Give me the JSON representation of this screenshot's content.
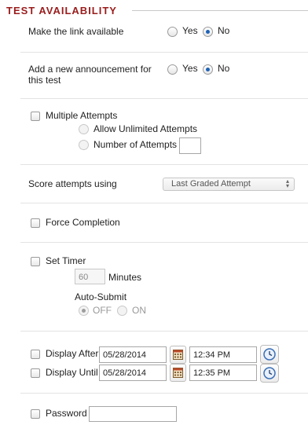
{
  "section": {
    "title": "TEST AVAILABILITY"
  },
  "make_link": {
    "label": "Make the link available",
    "yes": "Yes",
    "no": "No",
    "selected": "No"
  },
  "announcement": {
    "label_line1": "Add a new announcement for",
    "label_line2": "this test",
    "yes": "Yes",
    "no": "No",
    "selected": "No"
  },
  "multiple_attempts": {
    "label": "Multiple Attempts",
    "checked": false,
    "allow_unlimited": "Allow Unlimited Attempts",
    "number_of_attempts": "Number of Attempts",
    "number_value": ""
  },
  "score_attempts": {
    "label": "Score attempts using",
    "selected": "Last Graded Attempt"
  },
  "force_completion": {
    "label": "Force Completion",
    "checked": false
  },
  "set_timer": {
    "label": "Set Timer",
    "checked": false,
    "minutes_value": "60",
    "minutes_label": "Minutes",
    "auto_submit_label": "Auto-Submit",
    "off": "OFF",
    "on": "ON",
    "selected": "OFF"
  },
  "display_after": {
    "label": "Display After",
    "date": "05/28/2014",
    "time": "12:34 PM",
    "checked": false
  },
  "display_until": {
    "label": "Display Until",
    "date": "05/28/2014",
    "time": "12:35 PM",
    "checked": false
  },
  "password": {
    "label": "Password",
    "value": ""
  },
  "colors": {
    "section_title": "#9a1c1c",
    "radio_selected": "#1e63b6"
  },
  "icons": {
    "calendar": "calendar-icon",
    "clock": "clock-icon"
  }
}
